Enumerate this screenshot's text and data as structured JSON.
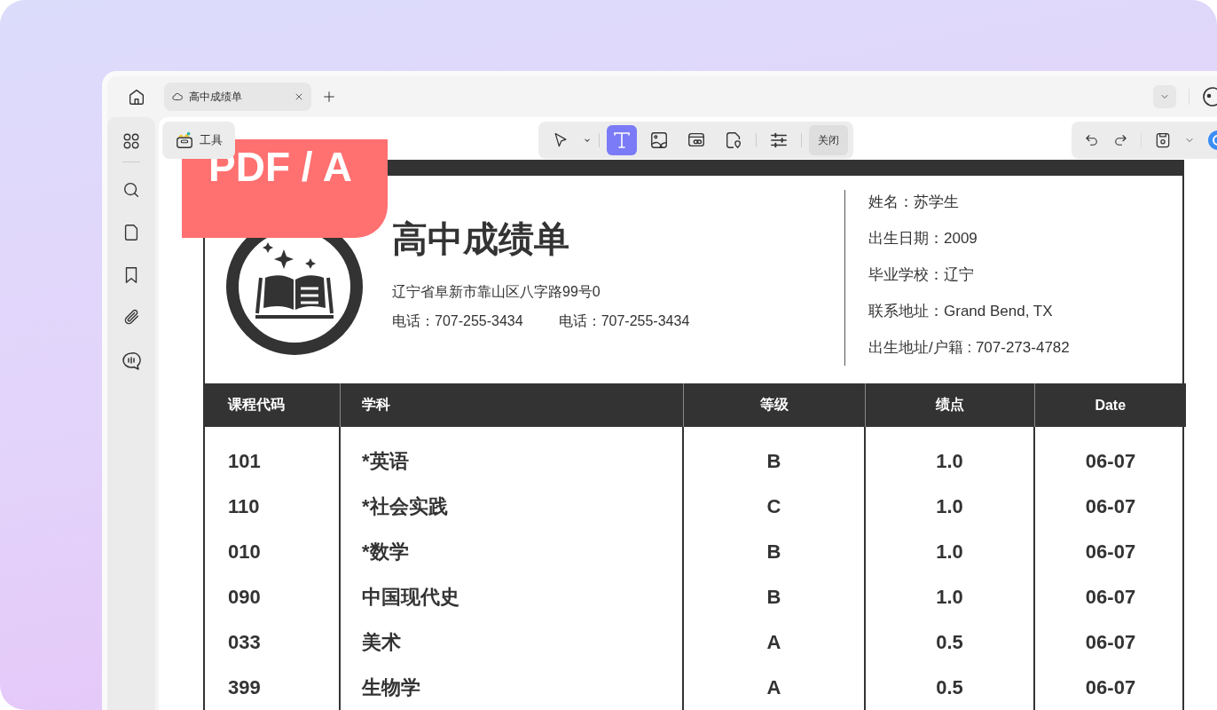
{
  "tab": {
    "title": "高中成绩单"
  },
  "tools_button": {
    "label": "工具"
  },
  "toolbar": {
    "tools": [
      {
        "kind": "select",
        "selected": false
      },
      {
        "kind": "text",
        "selected": true
      },
      {
        "kind": "image",
        "selected": false
      },
      {
        "kind": "link",
        "selected": false
      },
      {
        "kind": "stamp",
        "selected": false
      },
      {
        "kind": "properties",
        "selected": false
      }
    ],
    "close_label": "关闭"
  },
  "badge": "PDF / A",
  "document": {
    "title": "高中成绩单",
    "address": "辽宁省阜新市靠山区八字路99号0",
    "phones": [
      "电话：707-255-3434",
      "电话：707-255-3434"
    ],
    "info": [
      "姓名：苏学生",
      "出生日期：2009",
      "毕业学校：辽宁",
      "联系地址：Grand Bend, TX",
      "出生地址/户籍 : 707-273-4782"
    ],
    "table": {
      "columns": [
        "课程代码",
        "学科",
        "等级",
        "绩点",
        "Date"
      ],
      "rows": [
        [
          "101",
          "*英语",
          "B",
          "1.0",
          "06-07"
        ],
        [
          "110",
          "*社会实践",
          "C",
          "1.0",
          "06-07"
        ],
        [
          "010",
          "*数学",
          "B",
          "1.0",
          "06-07"
        ],
        [
          "090",
          "中国现代史",
          "B",
          "1.0",
          "06-07"
        ],
        [
          "033",
          "美术",
          "A",
          "0.5",
          "06-07"
        ],
        [
          "399",
          "生物学",
          "A",
          "0.5",
          "06-07"
        ]
      ]
    }
  }
}
